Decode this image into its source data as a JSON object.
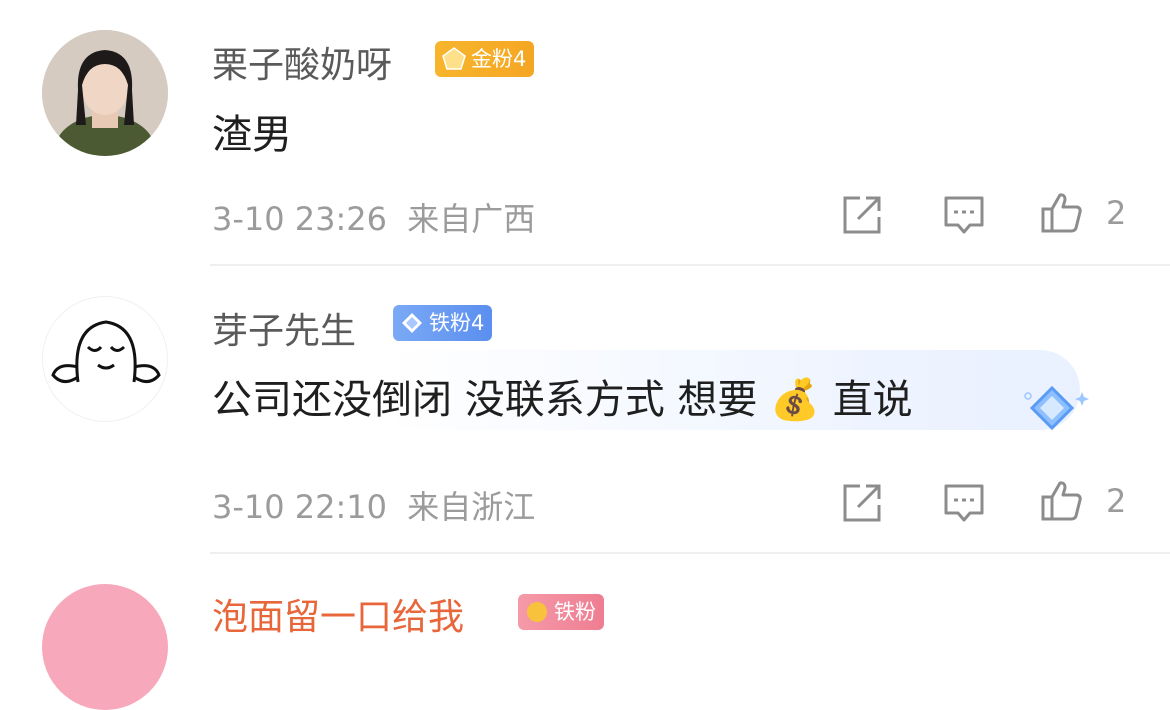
{
  "comments": [
    {
      "username": "栗子酸奶呀",
      "badge": {
        "label": "金粉4",
        "type": "gold"
      },
      "text": "渣男",
      "time": "3-10 23:26",
      "location": "来自广西",
      "likes": "2"
    },
    {
      "username": "芽子先生",
      "badge": {
        "label": "铁粉4",
        "type": "iron"
      },
      "text": "公司还没倒闭 没联系方式 想要",
      "emoji": "💰",
      "text_after": "直说",
      "time": "3-10 22:10",
      "location": "来自浙江",
      "likes": "2"
    },
    {
      "username": "泡面留一口给我",
      "badge": {
        "label": "铁粉",
        "type": "red"
      }
    }
  ],
  "colors": {
    "username": "#5a5a5a",
    "meta": "#9b9b9b",
    "gold_badge": "#f5a623",
    "iron_badge": "#5b8ff0",
    "partial_username": "#e8673a"
  },
  "icons": [
    "share-icon",
    "comment-icon",
    "like-icon"
  ]
}
